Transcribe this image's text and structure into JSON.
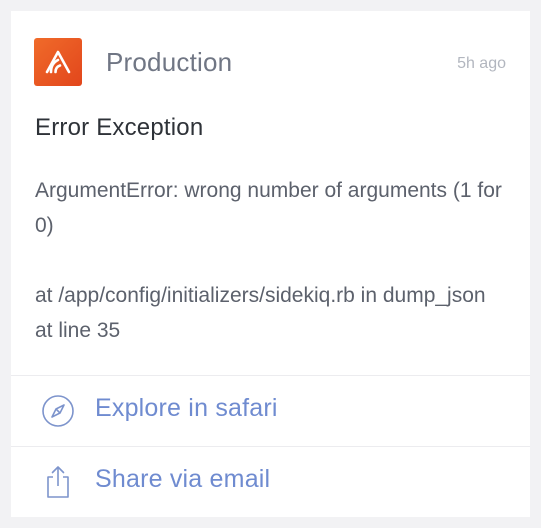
{
  "notification": {
    "app_icon": "sentry-logo-icon",
    "environment": "Production",
    "timestamp": "5h ago",
    "title": "Error Exception",
    "message_line1": "ArgumentError: wrong number of arguments (1 for 0)",
    "message_line2": "at /app/config/initializers/sidekiq.rb in dump_json at line 35"
  },
  "actions": [
    {
      "label": "Explore in safari",
      "icon": "compass-icon"
    },
    {
      "label": "Share via email",
      "icon": "share-icon"
    }
  ],
  "colors": {
    "background": "#f2f2f4",
    "card": "#ffffff",
    "brand": "#e8521f",
    "action_text": "#6f8bd0",
    "action_icon": "#7d94cc"
  }
}
